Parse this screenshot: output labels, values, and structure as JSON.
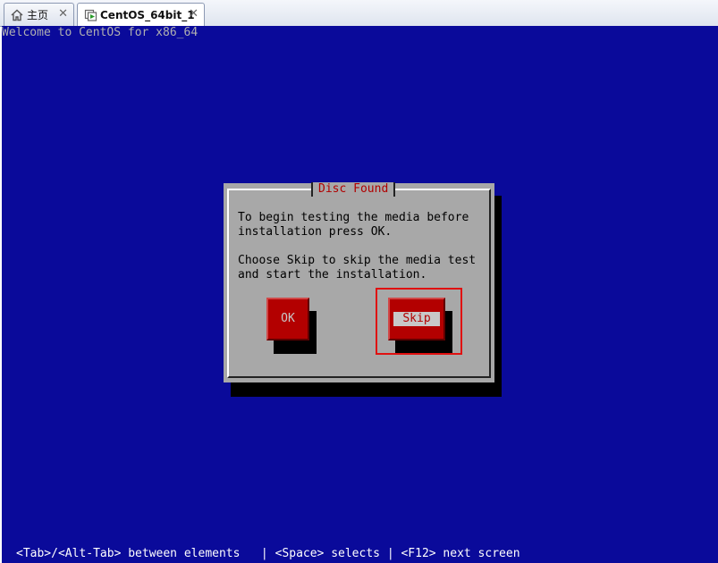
{
  "tabs": [
    {
      "label": "主页",
      "icon": "home-icon",
      "close": "✕"
    },
    {
      "label": "CentOS_64bit_1",
      "icon": "vm-icon",
      "close": "✕"
    }
  ],
  "console": {
    "welcome_text": "Welcome to CentOS for x86_64",
    "dialog": {
      "title": "Disc Found",
      "paragraph1_line1": "To begin testing the media before",
      "paragraph1_line2": "installation press OK.",
      "paragraph2_line1": "Choose Skip to skip the media test",
      "paragraph2_line2": "and start the installation.",
      "ok_label": "OK",
      "skip_label": "Skip"
    },
    "help_text": "<Tab>/<Alt-Tab> between elements   | <Space> selects | <F12> next screen"
  },
  "colors": {
    "background": "#0a0a9a",
    "dialog": "#a8a8a8",
    "button": "#b30000",
    "title": "#b00000",
    "annotation": "#e01010"
  }
}
